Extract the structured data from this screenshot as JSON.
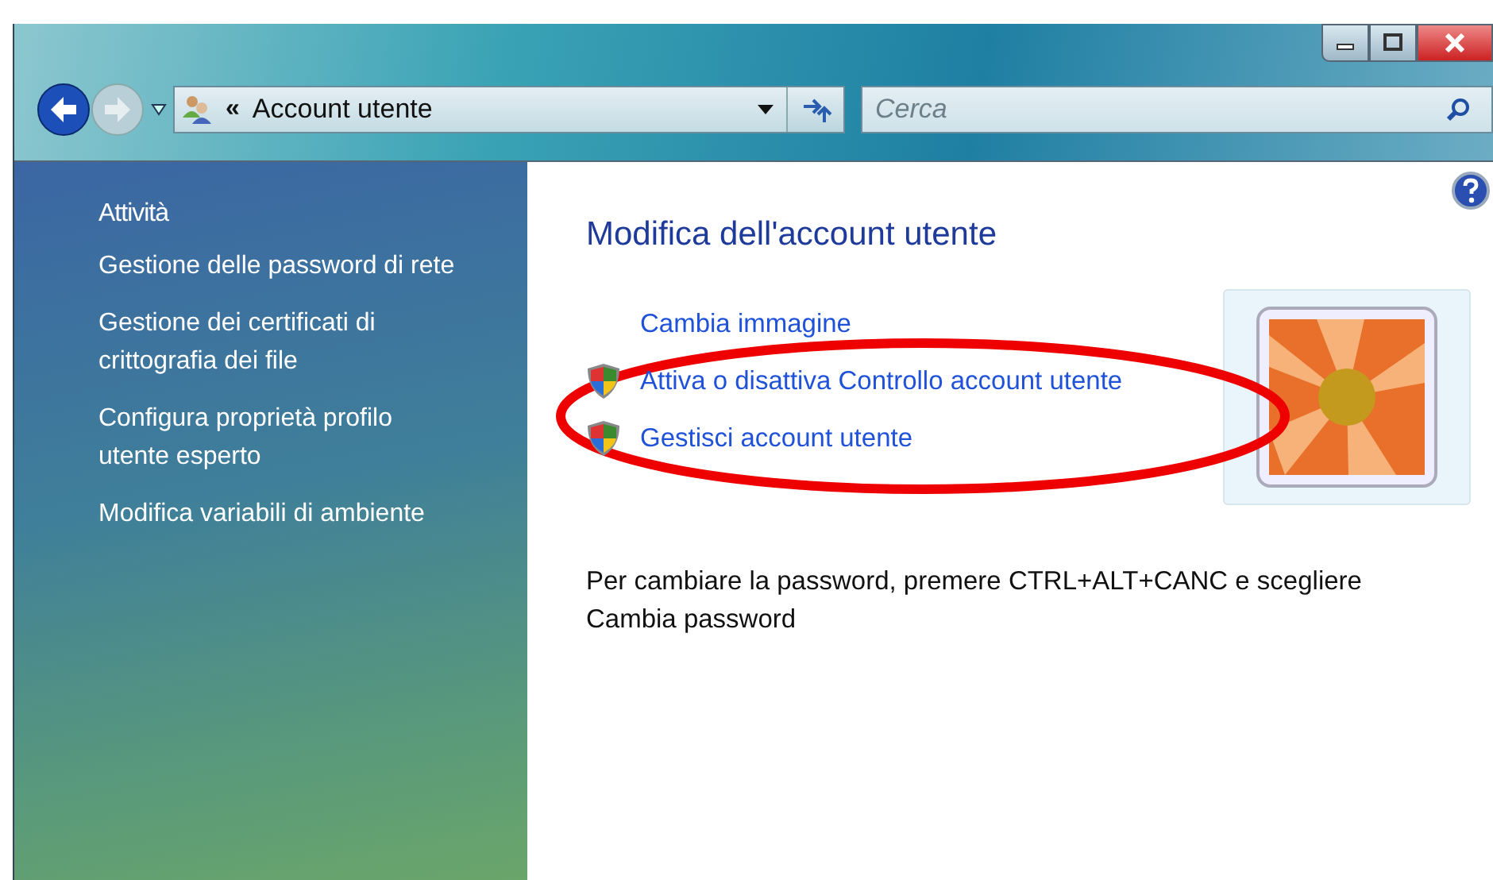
{
  "address_bar": {
    "separator": "«",
    "location": "Account utente"
  },
  "search": {
    "placeholder": "Cerca"
  },
  "sidebar": {
    "heading": "Attività",
    "items": [
      {
        "label": "Gestione delle password di rete"
      },
      {
        "label": "Gestione dei certificati di crittografia dei file"
      },
      {
        "label": "Configura proprietà profilo utente esperto"
      },
      {
        "label": "Modifica variabili di ambiente"
      }
    ]
  },
  "content": {
    "title": "Modifica dell'account utente",
    "links": [
      {
        "label": "Cambia immagine",
        "kind": "plain"
      },
      {
        "label": "Attiva o disattiva Controllo account utente",
        "kind": "shield"
      },
      {
        "label": "Gestisci account utente",
        "kind": "shield"
      }
    ],
    "note": "Per cambiare la password, premere CTRL+ALT+CANC e scegliere Cambia password"
  }
}
